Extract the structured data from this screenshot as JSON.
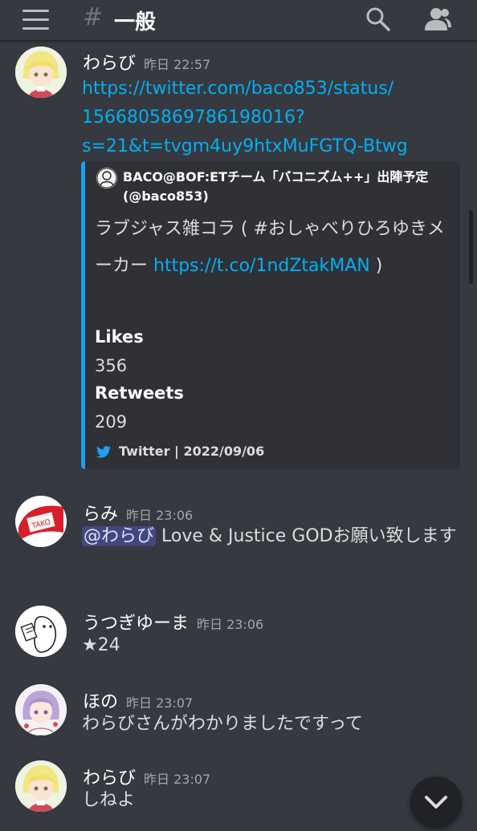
{
  "header": {
    "menu_icon": "hamburger-menu-icon",
    "hash_symbol": "#",
    "channel_name": "一般",
    "search_icon": "search-icon",
    "members_icon": "members-icon"
  },
  "messages": [
    {
      "author": "わらび",
      "time": "昨日 22:57",
      "link_lines": [
        "https://twitter.com/baco853/status/",
        "1566805869786198016?",
        "s=21&t=tvgm4uy9htxMuFGTQ-Btwg"
      ],
      "embed": {
        "author": "BACO@BOF:ETチーム「バコニズム++」出陣予定 (@baco853)",
        "desc_text": "ラブジャス雑コラ ( #おしゃべりひろゆきメーカー ",
        "desc_link": "https://t.co/1ndZtakMAN",
        "desc_end": " )",
        "fields": [
          {
            "name": "Likes",
            "value": "356"
          },
          {
            "name": "Retweets",
            "value": "209"
          }
        ],
        "footer": "Twitter | 2022/09/06",
        "accent_color": "#1da1f2"
      }
    },
    {
      "author": "らみ",
      "time": "昨日 23:06",
      "mention": "@わらび",
      "text": " Love & Justice GODお願い致します"
    },
    {
      "author": "うつぎゆーま",
      "time": "昨日 23:06",
      "text": "★24"
    },
    {
      "author": "ほの",
      "time": "昨日 23:07",
      "text": "わらびさんがわかりましたですって"
    },
    {
      "author": "わらび",
      "time": "昨日 23:07",
      "text": "しねよ"
    }
  ],
  "jump_button_icon": "chevron-down-icon",
  "colors": {
    "background": "#36393f",
    "link": "#00b0f4",
    "embed_bg": "#2f3136",
    "mention_bg": "#5865f2"
  }
}
